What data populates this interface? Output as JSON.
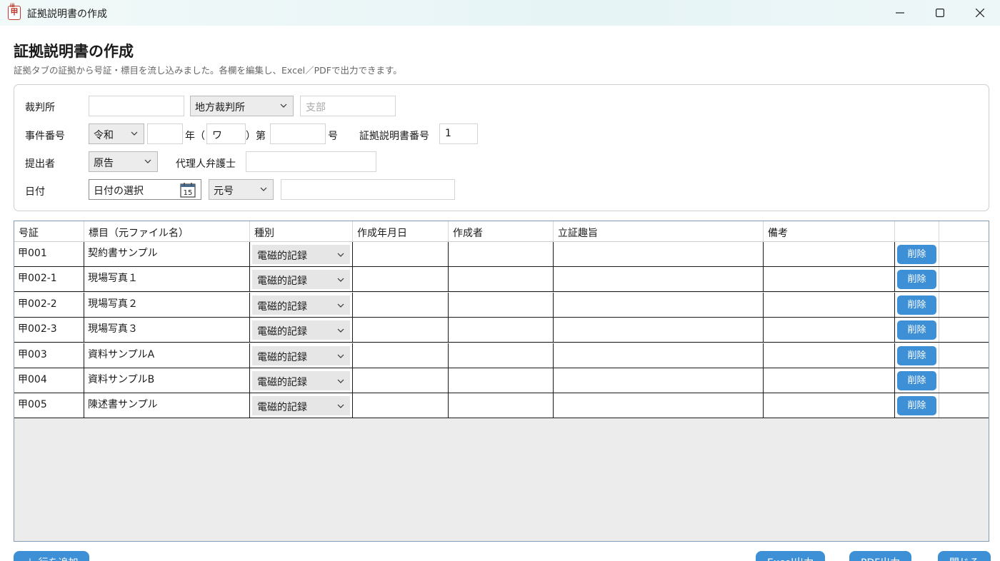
{
  "window": {
    "title": "証拠説明書の作成",
    "app_icon_glyph": "甲",
    "app_icon_tick": "ⅰⅱ",
    "icons": [
      "app-icon",
      "minimize-icon",
      "maximize-icon",
      "close-icon"
    ]
  },
  "page": {
    "title": "証拠説明書の作成",
    "subtitle": "証拠タブの証拠から号証・標目を流し込みました。各欄を編集し、Excel／PDFで出力できます。"
  },
  "form": {
    "court_label": "裁判所",
    "court_value": "",
    "court_type": "地方裁判所",
    "branch_placeholder": "支部",
    "case_number_label": "事件番号",
    "era": "令和",
    "year_value": "",
    "year_suffix": "年（",
    "case_symbol": "ワ",
    "case_symbol_suffix": "）第",
    "case_no_value": "",
    "case_no_suffix": "号",
    "doc_number_label": "証拠説明書番号",
    "doc_number_value": "1",
    "submitter_label": "提出者",
    "submitter_value": "原告",
    "attorney_label": "代理人弁護士",
    "attorney_value": "",
    "date_label": "日付",
    "date_placeholder": "日付の選択",
    "calendar_day": "15",
    "date_option": "元号",
    "date_text_value": ""
  },
  "grid": {
    "columns": [
      "号証",
      "標目（元ファイル名）",
      "種別",
      "作成年月日",
      "作成者",
      "立証趣旨",
      "備考",
      ""
    ],
    "rows": [
      {
        "no": "甲001",
        "title": "契約書サンプル",
        "type": "電磁的記録",
        "date": "",
        "author": "",
        "purpose": "",
        "note": "",
        "action": "削除"
      },
      {
        "no": "甲002-1",
        "title": "現場写真１",
        "type": "電磁的記録",
        "date": "",
        "author": "",
        "purpose": "",
        "note": "",
        "action": "削除"
      },
      {
        "no": "甲002-2",
        "title": "現場写真２",
        "type": "電磁的記録",
        "date": "",
        "author": "",
        "purpose": "",
        "note": "",
        "action": "削除"
      },
      {
        "no": "甲002-3",
        "title": "現場写真３",
        "type": "電磁的記録",
        "date": "",
        "author": "",
        "purpose": "",
        "note": "",
        "action": "削除"
      },
      {
        "no": "甲003",
        "title": "資料サンプルA",
        "type": "電磁的記録",
        "date": "",
        "author": "",
        "purpose": "",
        "note": "",
        "action": "削除"
      },
      {
        "no": "甲004",
        "title": "資料サンプルB",
        "type": "電磁的記録",
        "date": "",
        "author": "",
        "purpose": "",
        "note": "",
        "action": "削除"
      },
      {
        "no": "甲005",
        "title": "陳述書サンプル",
        "type": "電磁的記録",
        "date": "",
        "author": "",
        "purpose": "",
        "note": "",
        "action": "削除"
      }
    ]
  },
  "footer": {
    "add_row": "＋ 行を追加",
    "excel": "Excel出力",
    "pdf": "PDF出力",
    "close": "閉じる"
  },
  "colors": {
    "accent": "#3d8fd6",
    "titlebar": "#e6f4f6",
    "grid_bg": "#ececec",
    "app_icon": "#c0392b"
  }
}
